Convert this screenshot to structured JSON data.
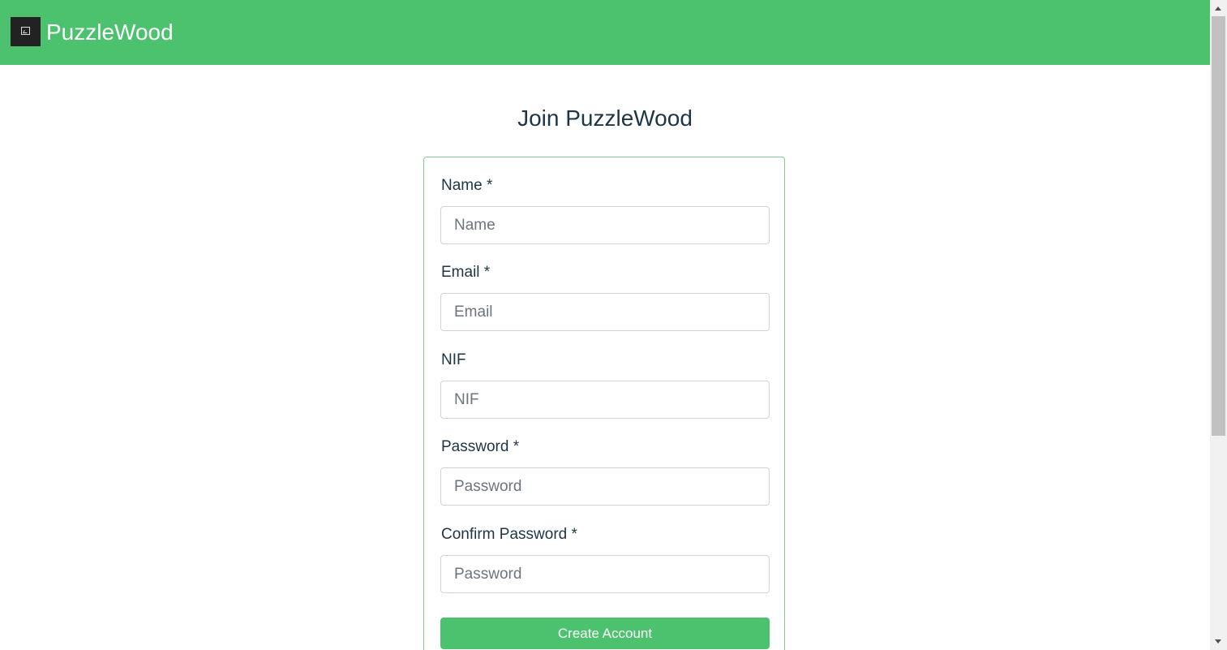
{
  "header": {
    "logo_icon": "image-icon",
    "brand": "PuzzleWood",
    "background_color": "#4cc16e"
  },
  "main": {
    "title": "Join PuzzleWood"
  },
  "form": {
    "fields": [
      {
        "label": "Name *",
        "placeholder": "Name",
        "value": ""
      },
      {
        "label": "Email *",
        "placeholder": "Email",
        "value": ""
      },
      {
        "label": "NIF",
        "placeholder": "NIF",
        "value": ""
      },
      {
        "label": "Password *",
        "placeholder": "Password",
        "value": ""
      },
      {
        "label": "Confirm Password *",
        "placeholder": "Password",
        "value": ""
      }
    ],
    "submit_label": "Create Account",
    "accent_color": "#4cc16e"
  }
}
